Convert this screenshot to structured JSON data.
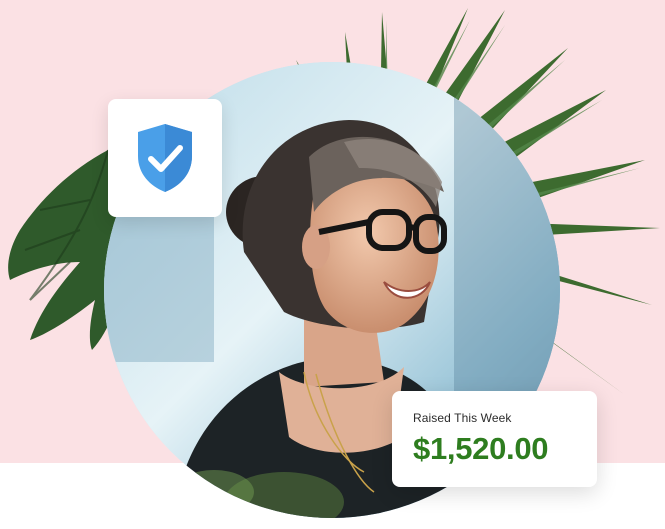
{
  "colors": {
    "background_pink": "#fbe1e4",
    "shield_blue": "#4a9fe8",
    "amount_green": "#2e7d1f"
  },
  "shield_badge": {
    "icon": "shield-check-icon"
  },
  "raised_card": {
    "label": "Raised This Week",
    "amount": "$1,520.00"
  },
  "hero_image": {
    "subject": "smiling-woman-with-glasses"
  }
}
